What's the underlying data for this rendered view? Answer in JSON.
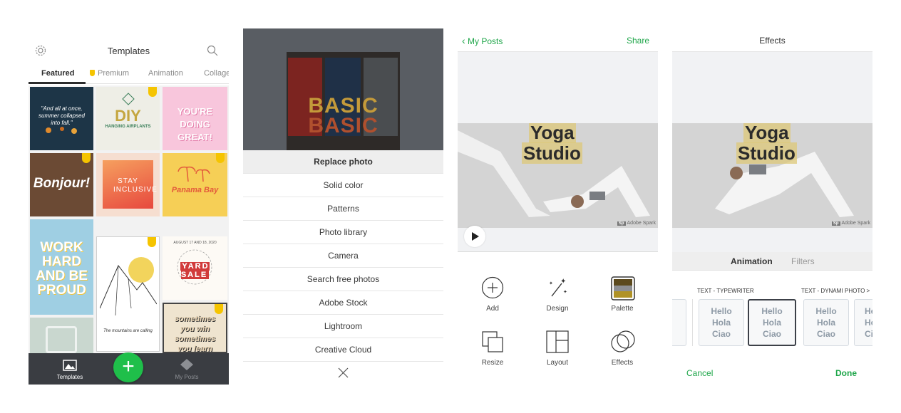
{
  "templates": {
    "title": "Templates",
    "tabs": [
      {
        "label": "Featured"
      },
      {
        "label": "Premium"
      },
      {
        "label": "Animation"
      },
      {
        "label": "Collage"
      }
    ],
    "tiles": [
      {
        "text": "\"And all at once, summer collapsed into fall.\""
      },
      {
        "text": "DIY",
        "subtext": "HANGING AIRPLANTS"
      },
      {
        "text": "YOU'RE DOING GREAT!"
      },
      {
        "text": "Bonjour!"
      },
      {
        "text": "STAY INCLUSIVE"
      },
      {
        "text": "Panama Bay"
      },
      {
        "text": "WORK HARD AND BE PROUD"
      },
      {
        "text": "The mountains are calling"
      },
      {
        "text": "YARD SALE",
        "subtext": "AUGUST 17 AND 18, 2020"
      },
      {
        "text": ""
      },
      {
        "text": ""
      },
      {
        "text": "sometimes you win sometimes you learn"
      }
    ],
    "bottom_nav": [
      {
        "label": "Templates"
      },
      {
        "label": "My Posts"
      }
    ],
    "fab_label": "+"
  },
  "replace_menu": {
    "photo_text": "BASIC",
    "items": [
      {
        "label": "Replace photo"
      },
      {
        "label": "Solid color"
      },
      {
        "label": "Patterns"
      },
      {
        "label": "Photo library"
      },
      {
        "label": "Camera"
      },
      {
        "label": "Search free photos"
      },
      {
        "label": "Adobe Stock"
      },
      {
        "label": "Lightroom"
      },
      {
        "label": "Creative Cloud"
      }
    ]
  },
  "editor": {
    "back_label": "My Posts",
    "share_label": "Share",
    "post_title_line1": "Yoga",
    "post_title_line2": "Studio",
    "watermark": "Adobe Spark",
    "watermark_badge": "Sp",
    "tools": [
      {
        "label": "Add",
        "icon": "plus-circle-icon"
      },
      {
        "label": "Design",
        "icon": "magic-wand-icon"
      },
      {
        "label": "Palette",
        "icon": "palette-icon"
      },
      {
        "label": "Resize",
        "icon": "resize-icon"
      },
      {
        "label": "Layout",
        "icon": "layout-icon"
      },
      {
        "label": "Effects",
        "icon": "effects-icon"
      }
    ],
    "palette_colors": [
      "#5c4a1e",
      "#8d8f93",
      "#b09226"
    ]
  },
  "effects": {
    "title": "Effects",
    "tabs": [
      {
        "label": "Animation"
      },
      {
        "label": "Filters"
      }
    ],
    "categories": [
      {
        "label": "TEXT - TYPEWRITER"
      },
      {
        "label": "TEXT - DYNAMI"
      },
      {
        "label": "PHOTO >"
      }
    ],
    "card_text": [
      "Hello",
      "Hola",
      "Ciao"
    ],
    "cancel_label": "Cancel",
    "done_label": "Done"
  },
  "colors": {
    "accent_green": "#1fa64a",
    "premium_yellow": "#f5c400",
    "nav_dark": "#3a3d42"
  }
}
